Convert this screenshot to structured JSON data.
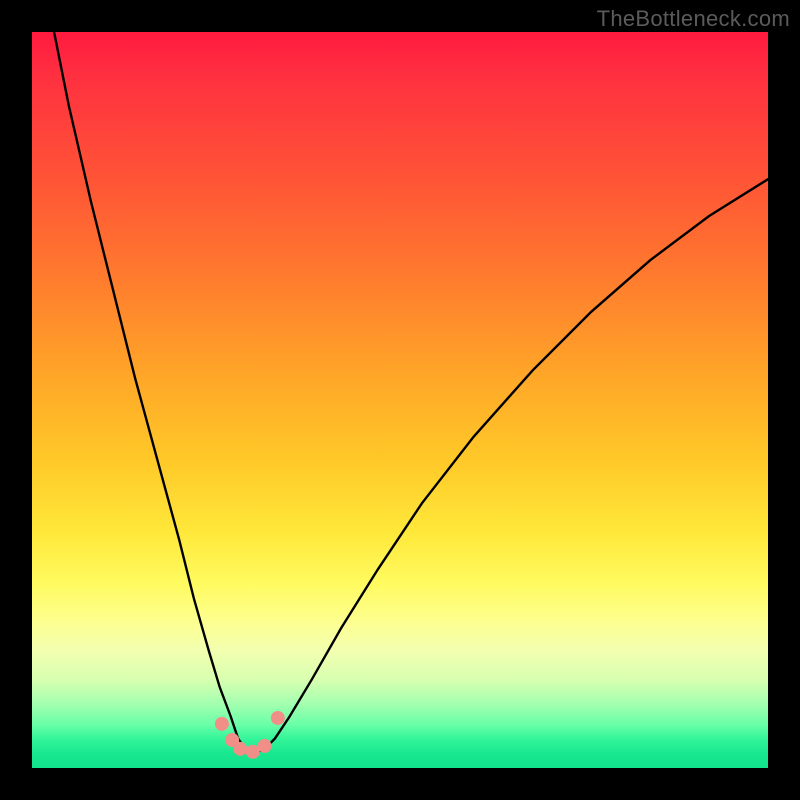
{
  "watermark": "TheBottleneck.com",
  "chart_data": {
    "type": "line",
    "title": "",
    "xlabel": "",
    "ylabel": "",
    "xlim": [
      0,
      100
    ],
    "ylim": [
      0,
      100
    ],
    "grid": false,
    "series": [
      {
        "name": "curve",
        "x": [
          3,
          5,
          8,
          11,
          14,
          17,
          20,
          22,
          24,
          25.5,
          27,
          28,
          29,
          30,
          31.5,
          33,
          35,
          38,
          42,
          47,
          53,
          60,
          68,
          76,
          84,
          92,
          100
        ],
        "y": [
          100,
          90,
          77,
          65,
          53,
          42,
          31,
          23,
          16,
          11,
          7,
          4,
          2.5,
          2,
          2.5,
          4,
          7,
          12,
          19,
          27,
          36,
          45,
          54,
          62,
          69,
          75,
          80
        ]
      }
    ],
    "annotations": {
      "dots_near_minimum": [
        {
          "x": 25.8,
          "y": 6.0
        },
        {
          "x": 27.2,
          "y": 3.8
        },
        {
          "x": 28.3,
          "y": 2.6
        },
        {
          "x": 30.0,
          "y": 2.2
        },
        {
          "x": 31.6,
          "y": 3.0
        },
        {
          "x": 33.4,
          "y": 6.8
        }
      ]
    },
    "background_gradient": {
      "top": "#ff1a3f",
      "mid1": "#ffa428",
      "mid2": "#fffb60",
      "bottom": "#10e48c"
    }
  }
}
